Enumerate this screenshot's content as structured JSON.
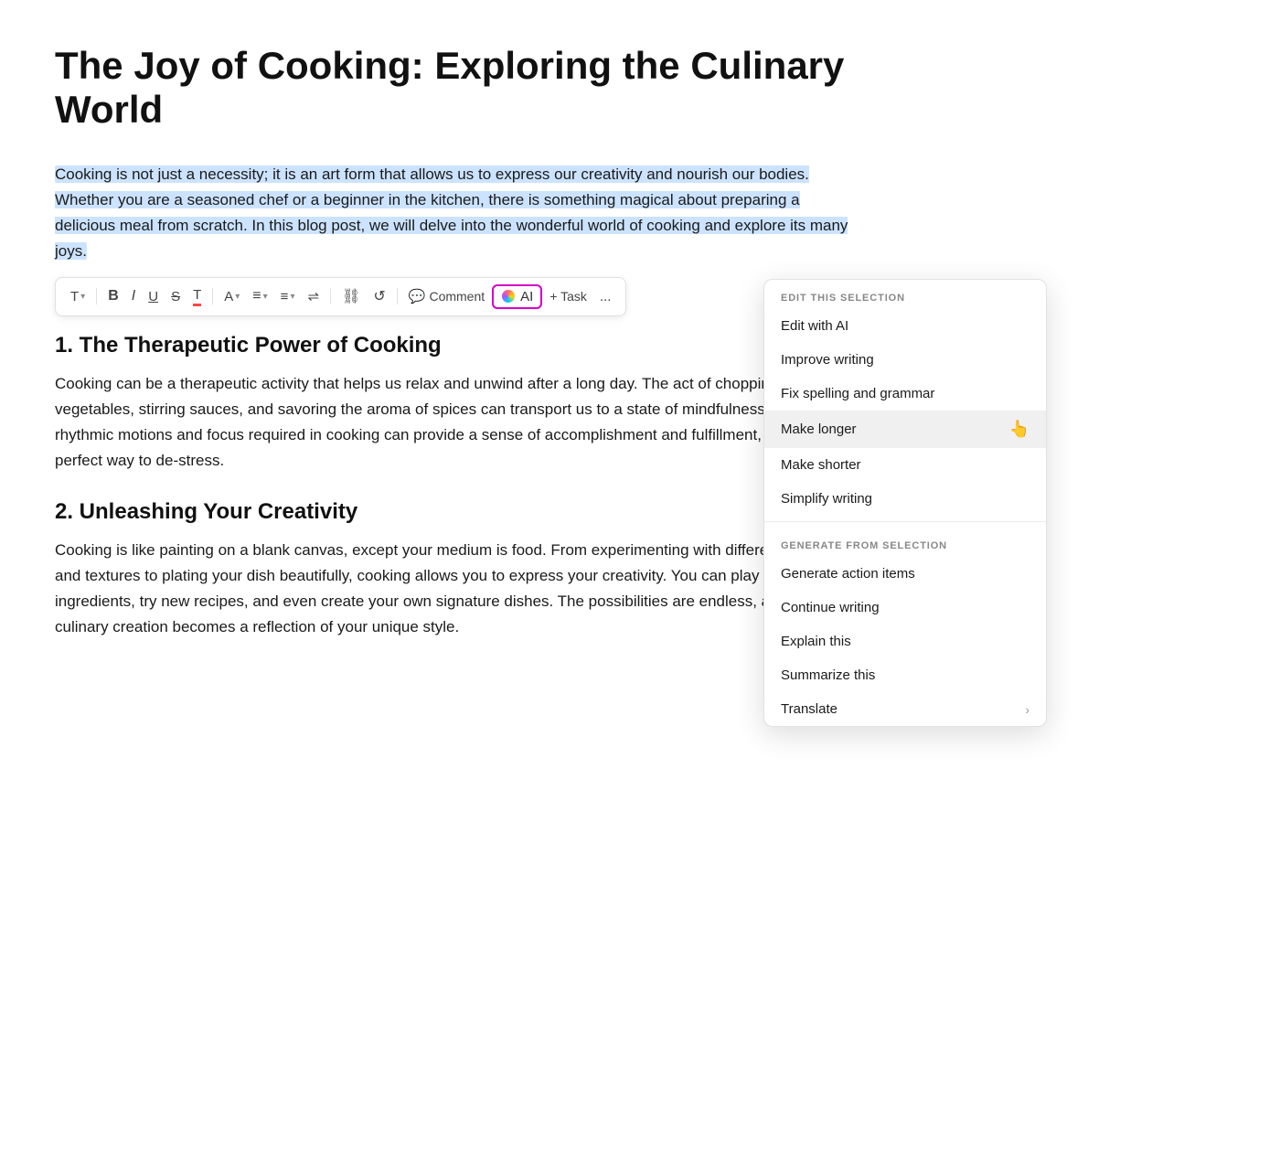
{
  "document": {
    "title": "The Joy of Cooking: Exploring the Culinary World",
    "selected_paragraph": "Cooking is not just a necessity; it is an art form that allows us to express our creativity and nourish our bodies. Whether you are a seasoned chef or a beginner in the kitchen, there is something magical about preparing a delicious meal from scratch. In this blog post, we will delve into the wonderful world of cooking and explore its many joys.",
    "sections": [
      {
        "heading": "1. The Therapeutic Power of Cooking",
        "body": "Cooking can be a therapeutic activity that helps us relax and unwind after a long day. The act of chopping vegetables, stirring sauces, and savoring the aroma of spices can transport us to a state of mindfulness. The rhythmic motions and focus required in cooking can provide a sense of accomplishment and fulfillment, making it a perfect way to de-stress."
      },
      {
        "heading": "2. Unleashing Your Creativity",
        "body": "Cooking is like painting on a blank canvas, except your medium is food. From experimenting with different flavors and textures to plating your dish beautifully, cooking allows you to express your creativity. You can play with ingredients, try new recipes, and even create your own signature dishes. The possibilities are endless, and each culinary creation becomes a reflection of your unique style."
      }
    ]
  },
  "toolbar": {
    "text_label": "T",
    "bold_label": "B",
    "italic_label": "I",
    "underline_label": "U",
    "strikethrough_label": "S",
    "highlight_label": "T",
    "font_color_label": "A",
    "align_label": "≡",
    "list_label": "≡",
    "indent_label": "⇥",
    "link_label": "🔗",
    "refresh_label": "↺",
    "comment_label": "Comment",
    "ai_label": "AI",
    "task_label": "+ Task",
    "more_label": "..."
  },
  "ai_menu": {
    "edit_section_label": "EDIT THIS SELECTION",
    "generate_section_label": "GENERATE FROM SELECTION",
    "edit_items": [
      {
        "id": "edit-with-ai",
        "label": "Edit with AI",
        "has_arrow": false
      },
      {
        "id": "improve-writing",
        "label": "Improve writing",
        "has_arrow": false
      },
      {
        "id": "fix-spelling",
        "label": "Fix spelling and grammar",
        "has_arrow": false
      },
      {
        "id": "make-longer",
        "label": "Make longer",
        "has_arrow": false,
        "hovered": true
      },
      {
        "id": "make-shorter",
        "label": "Make shorter",
        "has_arrow": false
      },
      {
        "id": "simplify-writing",
        "label": "Simplify writing",
        "has_arrow": false
      }
    ],
    "generate_items": [
      {
        "id": "generate-action-items",
        "label": "Generate action items",
        "has_arrow": false
      },
      {
        "id": "continue-writing",
        "label": "Continue writing",
        "has_arrow": false
      },
      {
        "id": "explain-this",
        "label": "Explain this",
        "has_arrow": false
      },
      {
        "id": "summarize-this",
        "label": "Summarize this",
        "has_arrow": false
      },
      {
        "id": "translate",
        "label": "Translate",
        "has_arrow": true
      }
    ]
  }
}
